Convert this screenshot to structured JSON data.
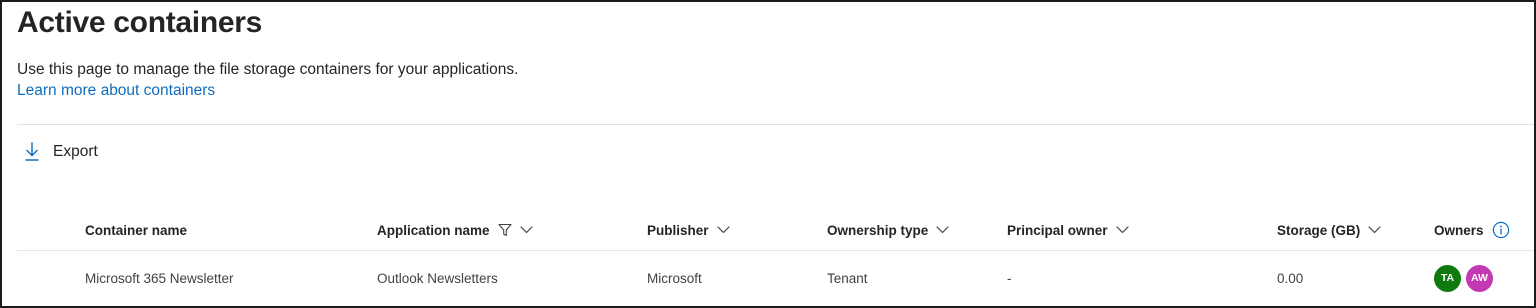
{
  "page": {
    "title": "Active containers",
    "description": "Use this page to manage the file storage containers for your applications.",
    "learn_more": "Learn more about containers"
  },
  "toolbar": {
    "export_label": "Export",
    "export_icon": "download-icon"
  },
  "table": {
    "columns": [
      {
        "label": "Container name",
        "sortable": false,
        "filter": false
      },
      {
        "label": "Application name",
        "sortable": true,
        "filter": true
      },
      {
        "label": "Publisher",
        "sortable": true,
        "filter": false
      },
      {
        "label": "Ownership type",
        "sortable": true,
        "filter": false
      },
      {
        "label": "Principal owner",
        "sortable": true,
        "filter": false
      },
      {
        "label": "Storage (GB)",
        "sortable": true,
        "filter": false
      },
      {
        "label": "Owners",
        "sortable": false,
        "info": true
      }
    ],
    "rows": [
      {
        "container_name": "Microsoft 365 Newsletter",
        "application_name": "Outlook Newsletters",
        "publisher": "Microsoft",
        "ownership_type": "Tenant",
        "principal_owner": "-",
        "storage_gb": "0.00",
        "owners": [
          {
            "initials": "TA",
            "color": "#0e7a0d"
          },
          {
            "initials": "AW",
            "color": "#c239b3"
          }
        ]
      }
    ]
  },
  "colors": {
    "link": "#0f6cbd",
    "text": "#242424",
    "divider": "#e0e0e0"
  }
}
